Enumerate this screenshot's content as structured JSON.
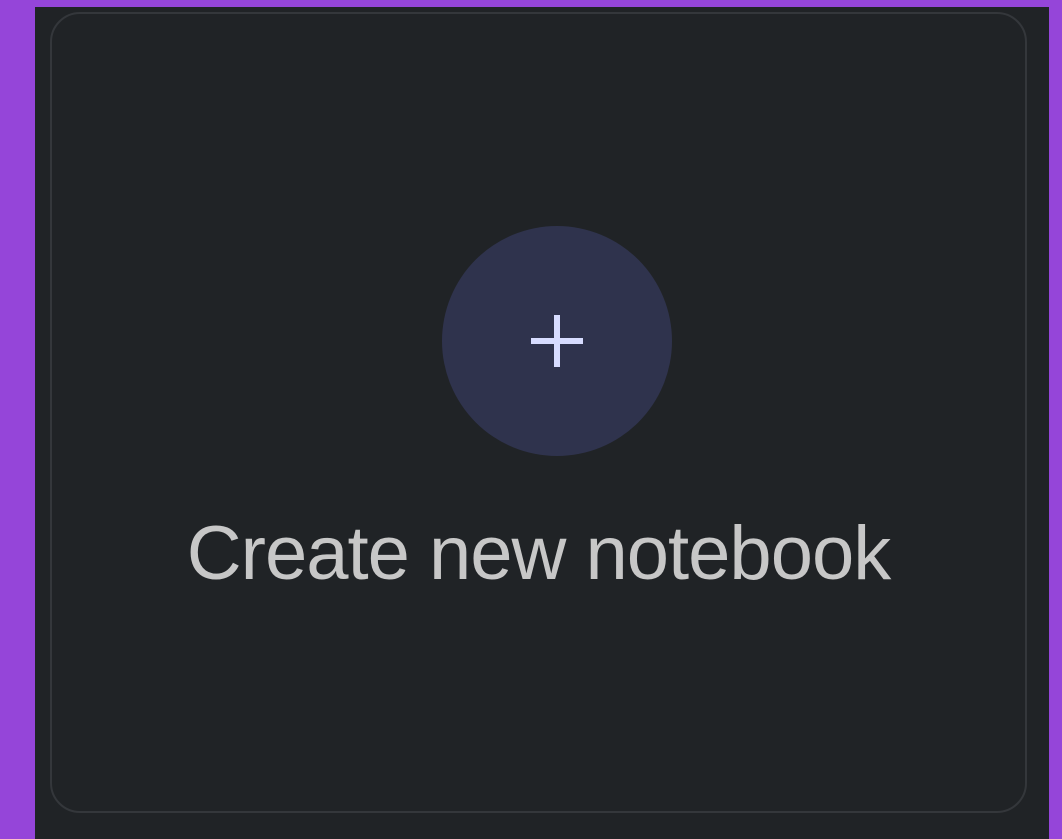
{
  "card": {
    "label": "Create new notebook",
    "icon": "plus-icon"
  },
  "colors": {
    "page_background": "#9545D9",
    "panel_background": "#202326",
    "card_border": "#34373b",
    "icon_circle": "#2f334d",
    "icon_color": "#d7dcff",
    "label_color": "#c7c7c7"
  }
}
